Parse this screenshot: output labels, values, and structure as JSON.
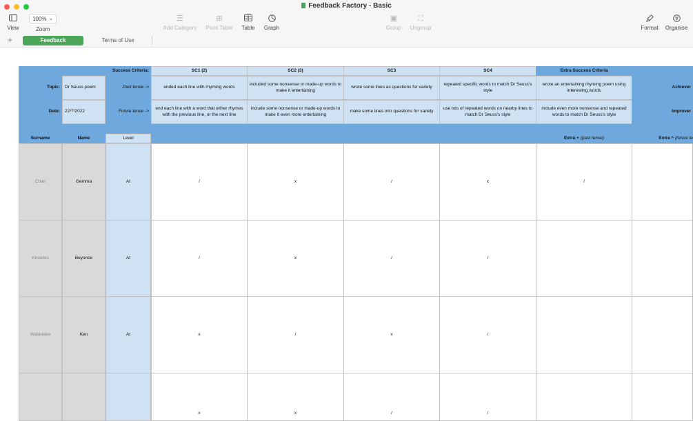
{
  "window": {
    "title": "Feedback Factory - Basic"
  },
  "toolbar": {
    "view": "View",
    "zoom_value": "100%",
    "zoom": "Zoom",
    "add_category": "Add Category",
    "pivot_table": "Pivot Table",
    "table": "Table",
    "graph": "Graph",
    "group": "Group",
    "ungroup": "Ungroup",
    "format": "Format",
    "organise": "Organise"
  },
  "sheets": {
    "add": "+",
    "active": "Feedback",
    "other": "Terms of Use"
  },
  "header": {
    "success_criteria": "Success Criteria:",
    "sc1": "SC1 (2)",
    "sc2": "SC2 (3)",
    "sc3": "SC3",
    "sc4": "SC4",
    "extra": "Extra Success Criteria",
    "topic_label": "Topic:",
    "topic_value": "Dr Seuss poem",
    "past_tense": "Past tense ->",
    "date_label": "Date:",
    "date_value": "22/7/2022",
    "future_tense": "Future tense ->",
    "achieved": "Achiever",
    "improve": "Improver",
    "past": [
      "ended each line with rhyming words",
      "included some nonsense or made-up words to make it entertaining",
      "wrote some lines as questions for variety",
      "repeated specific words to match Dr Seuss's style",
      "wrote an entertaining rhyming poem using interesting words"
    ],
    "future": [
      "end each line with a word that either rhymes with the previous line, or the next line",
      "include some nonsense or made-up words to make it even more entertaining",
      "make some lines into questions for variety",
      "use lots of repeated words on nearby lines to match Dr Seuss's style",
      "include even more nonsense and repeated words to match Dr Seuss's style"
    ]
  },
  "columns": {
    "surname": "Surname",
    "name": "Name",
    "level": "Level",
    "extra_plus": "Extra +",
    "extra_plus_note": "(past tense)",
    "extra_caret": "Extra ^",
    "extra_caret_note": "(future te"
  },
  "rows": [
    {
      "surname": "Chan",
      "name": "Gemma",
      "level": "At",
      "marks": [
        "/",
        "x",
        "/",
        "x",
        "/"
      ]
    },
    {
      "surname": "Knowles",
      "name": "Beyonce",
      "level": "At",
      "marks": [
        "/",
        "x",
        "/",
        "/",
        ""
      ]
    },
    {
      "surname": "Watanabe",
      "name": "Ken",
      "level": "At",
      "marks": [
        "x",
        "/",
        "x",
        "/",
        ""
      ]
    },
    {
      "surname": "",
      "name": "",
      "level": "",
      "marks": [
        "x",
        "x",
        "/",
        "/",
        ""
      ]
    }
  ]
}
